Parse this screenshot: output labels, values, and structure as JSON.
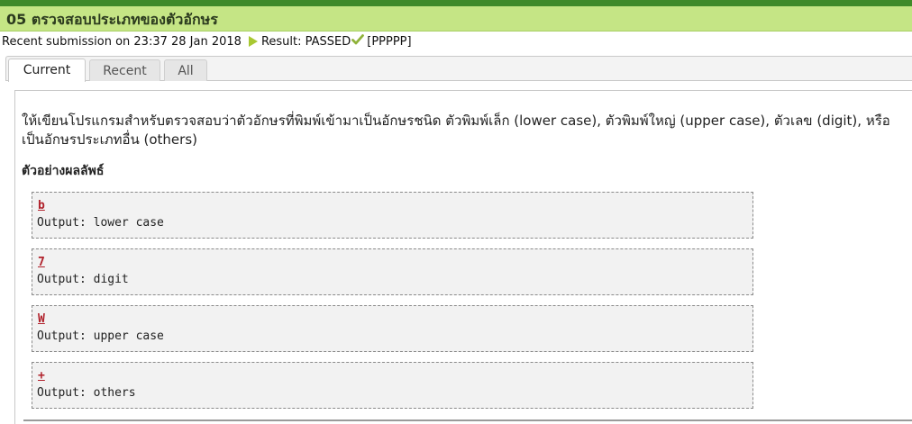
{
  "problem": {
    "title": "05 ตรวจสอบประเภทของตัวอักษร"
  },
  "submission": {
    "prefix": "Recent submission on 23:37 28 Jan 2018",
    "result": "Result: PASSED",
    "detail": "[PPPPP]"
  },
  "tabs": [
    {
      "label": "Current",
      "active": true
    },
    {
      "label": "Recent",
      "active": false
    },
    {
      "label": "All",
      "active": false
    }
  ],
  "content": {
    "description": "ให้เขียนโปรแกรมสำหรับตรวจสอบว่าตัวอักษรที่พิมพ์เข้ามาเป็นอักษรชนิด ตัวพิมพ์เล็ก (lower case), ตัวพิมพ์ใหญ่ (upper case), ตัวเลข (digit), หรือเป็นอักษรประเภทอื่น (others)",
    "example_heading": "ตัวอย่างผลลัพธ์",
    "examples": [
      {
        "input": "b",
        "output": "Output: lower case"
      },
      {
        "input": "7",
        "output": "Output: digit"
      },
      {
        "input": "W",
        "output": "Output: upper case"
      },
      {
        "input": "+",
        "output": "Output: others"
      }
    ]
  },
  "colors": {
    "top_strip": "#3f8a2a",
    "title_bar": "#c5e585",
    "input_text": "#b0202a"
  },
  "icons": {
    "result_play": "play-arrow-icon",
    "result_pass": "checkmark-icon"
  }
}
